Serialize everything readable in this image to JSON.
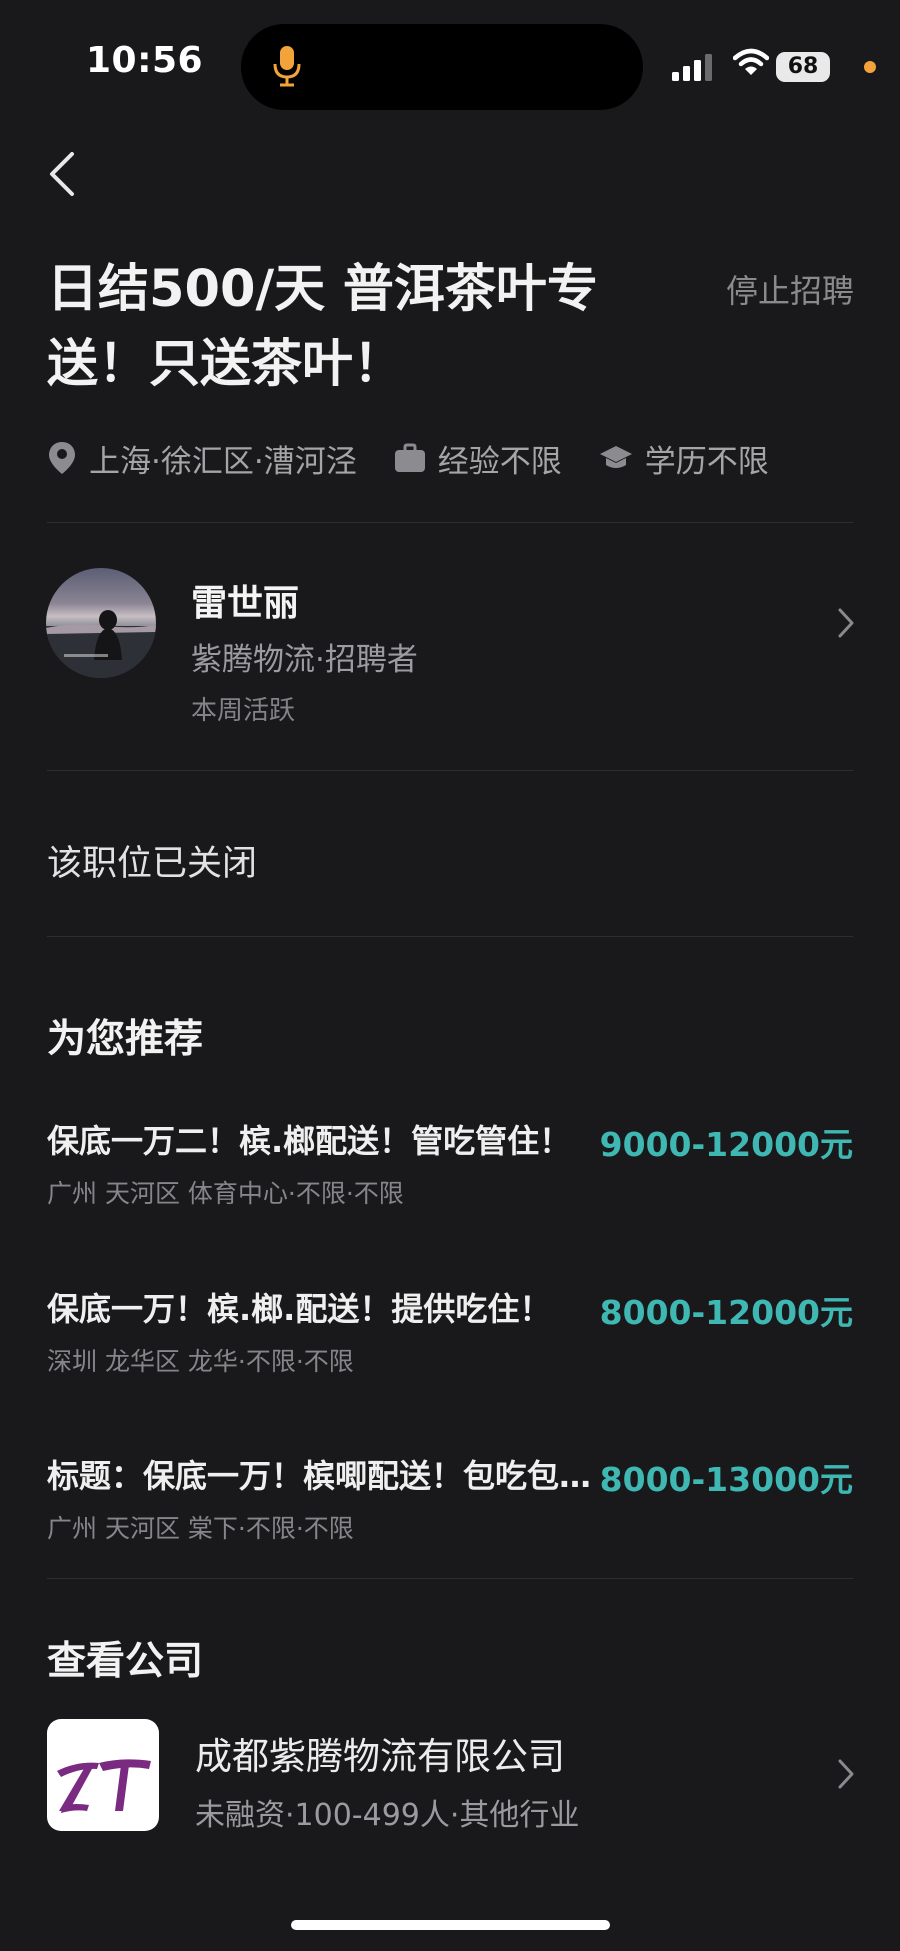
{
  "status_bar": {
    "time": "10:56",
    "battery": "68",
    "icons": [
      "mic-icon",
      "signal-icon",
      "wifi-icon",
      "battery-icon"
    ]
  },
  "header": {
    "back_icon": "chevron-left-icon"
  },
  "job": {
    "title": "日结500/天  普洱茶叶专\n送！只送茶叶！",
    "status_label": "停止招聘",
    "location": "上海·徐汇区·漕河泾",
    "experience": "经验不限",
    "education": "学历不限"
  },
  "recruiter": {
    "name": "雷世丽",
    "company_role": "紫腾物流·招聘者",
    "activity": "本周活跃"
  },
  "closed_notice": "该职位已关闭",
  "recommend": {
    "title": "为您推荐",
    "items": [
      {
        "title": "保底一万二！槟.榔配送！管吃管住！",
        "salary": "9000-12000元",
        "sub": "广州 天河区 体育中心·不限·不限"
      },
      {
        "title": "保底一万！槟.榔.配送！提供吃住！",
        "salary": "8000-12000元",
        "sub": "深圳 龙华区 龙华·不限·不限"
      },
      {
        "title": "标题：保底一万！槟唧配送！包吃包住！",
        "salary": "8000-13000元",
        "sub": "广州 天河区 棠下·不限·不限"
      }
    ]
  },
  "company": {
    "section_title": "查看公司",
    "name": "成都紫腾物流有限公司",
    "info": "未融资·100-499人·其他行业",
    "logo_text": "ZT"
  },
  "colors": {
    "background": "#19191b",
    "salary": "#3fb8b4",
    "logo_purple": "#7b2a82",
    "status_dot": "#f2a33a"
  }
}
